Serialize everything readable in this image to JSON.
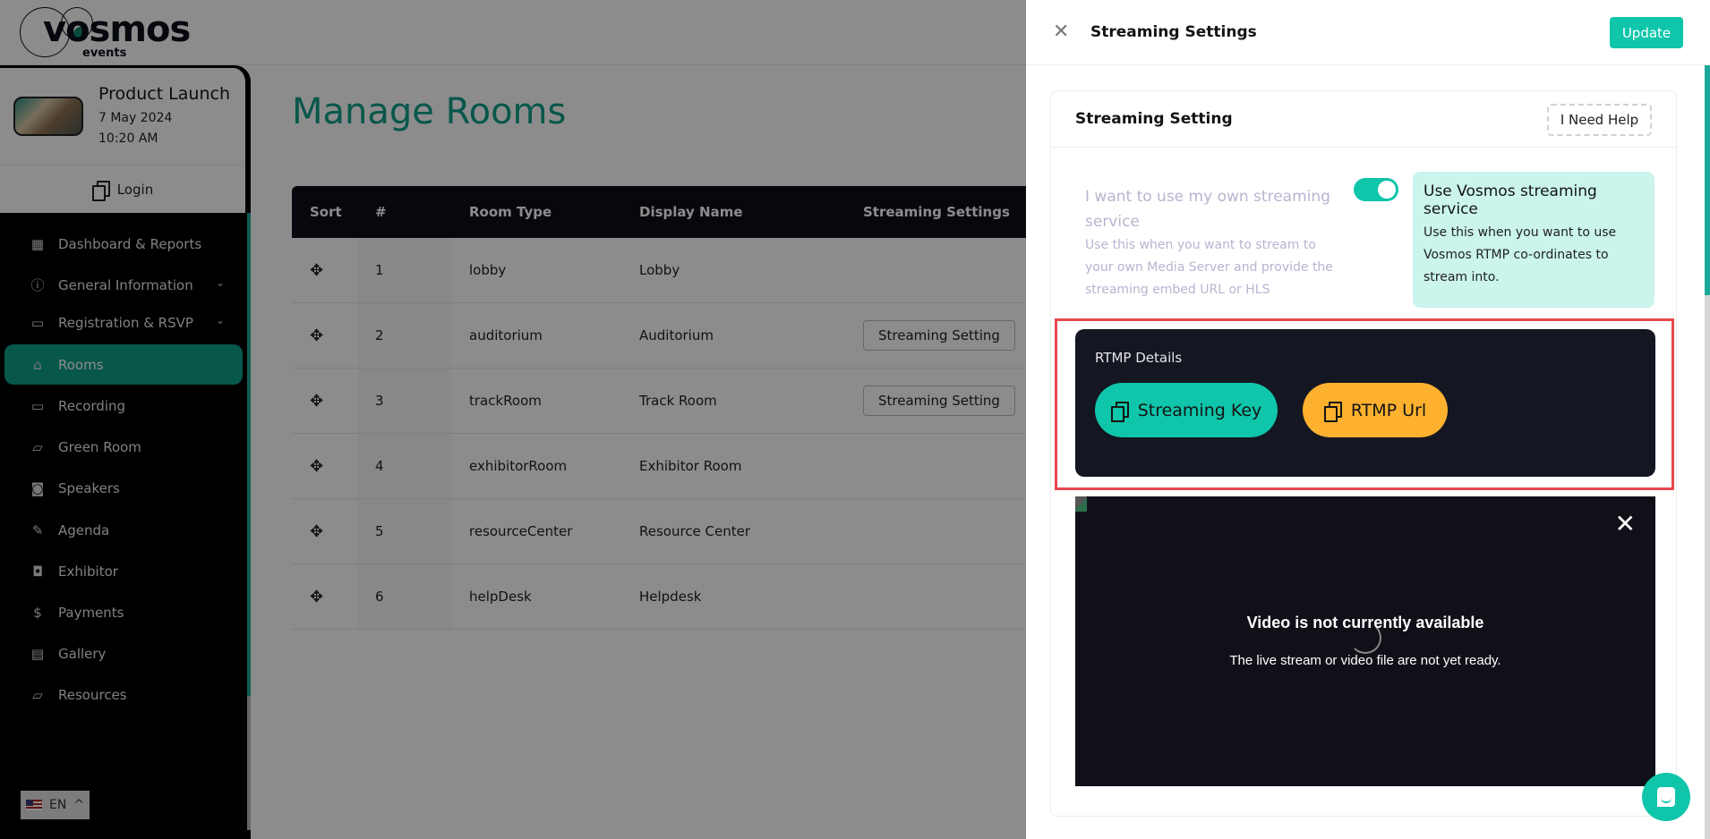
{
  "app": {
    "logo": {
      "word": "vosmos",
      "sub": "events"
    },
    "event": {
      "title": "Product Launch",
      "date": "7 May 2024",
      "time": "10:20 AM",
      "login_label": "Login"
    },
    "sidebar": {
      "items": [
        {
          "label": "Dashboard & Reports",
          "icon": "grid-icon",
          "glyph": "▦",
          "chevron": false,
          "active": false
        },
        {
          "label": "General Information",
          "icon": "info-icon",
          "glyph": "ⓘ",
          "chevron": true,
          "active": false
        },
        {
          "label": "Registration & RSVP",
          "icon": "calendar-icon",
          "glyph": "▭",
          "chevron": true,
          "active": false
        },
        {
          "label": "Rooms",
          "icon": "home-icon",
          "glyph": "⌂",
          "chevron": false,
          "active": true
        },
        {
          "label": "Recording",
          "icon": "video-icon",
          "glyph": "▭",
          "chevron": false,
          "active": false
        },
        {
          "label": "Green Room",
          "icon": "folder-icon",
          "glyph": "▱",
          "chevron": false,
          "active": false
        },
        {
          "label": "Speakers",
          "icon": "speaker-icon",
          "glyph": "◙",
          "chevron": false,
          "active": false
        },
        {
          "label": "Agenda",
          "icon": "agenda-icon",
          "glyph": "✎",
          "chevron": false,
          "active": false
        },
        {
          "label": "Exhibitor",
          "icon": "exhibitor-icon",
          "glyph": "◘",
          "chevron": false,
          "active": false
        },
        {
          "label": "Payments",
          "icon": "payments-icon",
          "glyph": "$",
          "chevron": false,
          "active": false
        },
        {
          "label": "Gallery",
          "icon": "gallery-icon",
          "glyph": "▤",
          "chevron": false,
          "active": false
        },
        {
          "label": "Resources",
          "icon": "resources-icon",
          "glyph": "▱",
          "chevron": false,
          "active": false
        }
      ]
    },
    "language": {
      "code": "EN",
      "chevron": "^"
    }
  },
  "main": {
    "title": "Manage Rooms",
    "table": {
      "headers": [
        "Sort",
        "#",
        "Room Type",
        "Display Name",
        "Streaming Settings"
      ],
      "rows": [
        {
          "num": "1",
          "type": "lobby",
          "name": "Lobby",
          "stream_button": ""
        },
        {
          "num": "2",
          "type": "auditorium",
          "name": "Auditorium",
          "stream_button": "Streaming Setting"
        },
        {
          "num": "3",
          "type": "trackRoom",
          "name": "Track Room",
          "stream_button": "Streaming Setting"
        },
        {
          "num": "4",
          "type": "exhibitorRoom",
          "name": "Exhibitor Room",
          "stream_button": ""
        },
        {
          "num": "5",
          "type": "resourceCenter",
          "name": "Resource Center",
          "stream_button": ""
        },
        {
          "num": "6",
          "type": "helpDesk",
          "name": "Helpdesk",
          "stream_button": ""
        }
      ]
    }
  },
  "drawer": {
    "title": "Streaming Settings",
    "update_label": "Update",
    "card": {
      "title": "Streaming Setting",
      "help_label": "I Need Help",
      "own_service": {
        "title": "I want to use my own streaming service",
        "description": "Use this when you want to stream to your own Media Server and provide the streaming embed URL or HLS"
      },
      "toggle_on": true,
      "vosmos_service": {
        "title": "Use Vosmos streaming service",
        "description": "Use this when you want to use Vosmos RTMP co-ordinates to stream into."
      },
      "rtmp": {
        "label": "RTMP Details",
        "streaming_key_label": "Streaming Key",
        "rtmp_url_label": "RTMP Url"
      },
      "video": {
        "title": "Video is not currently available",
        "message": "The live stream or video file are not yet ready."
      }
    }
  },
  "colors": {
    "accent": "#0fc5aa",
    "active_nav": "#0e9e88",
    "rtmp_url": "#fdb12f",
    "highlight": "#e9474f",
    "vosmos_box": "#caf4ec"
  }
}
